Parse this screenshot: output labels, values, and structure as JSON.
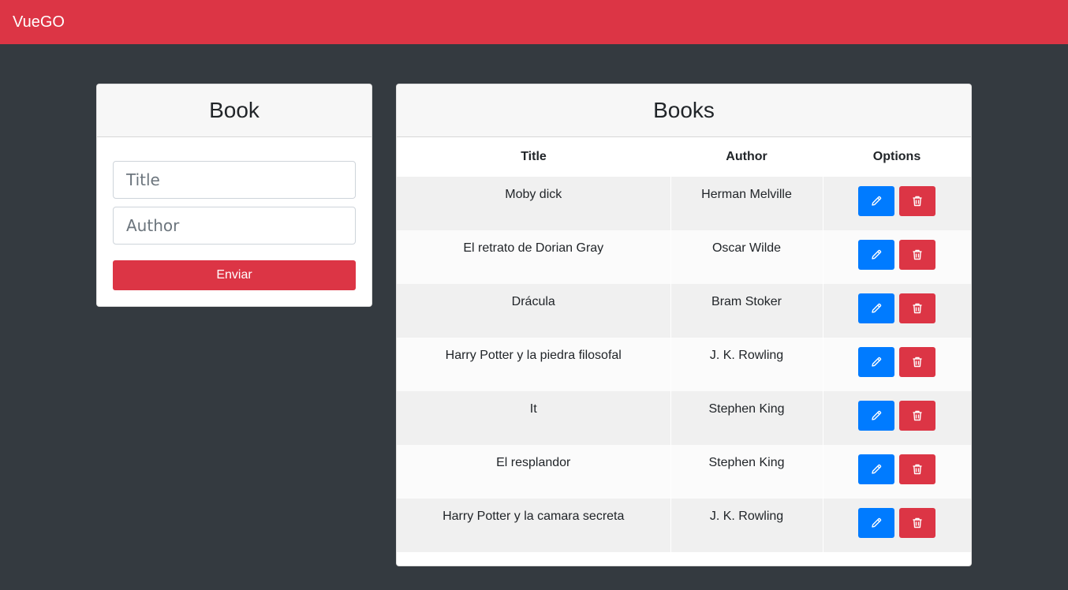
{
  "navbar": {
    "brand": "VueGO",
    "color": "#dc3545"
  },
  "form": {
    "header": "Book",
    "title_placeholder": "Title",
    "author_placeholder": "Author",
    "title_value": "",
    "author_value": "",
    "submit_label": "Enviar"
  },
  "books": {
    "header": "Books",
    "columns": [
      "Title",
      "Author",
      "Options"
    ],
    "rows": [
      {
        "title": "Moby dick",
        "author": "Herman Melville"
      },
      {
        "title": "El retrato de Dorian Gray",
        "author": "Oscar Wilde"
      },
      {
        "title": "Drácula",
        "author": "Bram Stoker"
      },
      {
        "title": "Harry Potter y la piedra filosofal",
        "author": "J. K. Rowling"
      },
      {
        "title": "It",
        "author": "Stephen King"
      },
      {
        "title": "El resplandor",
        "author": "Stephen King"
      },
      {
        "title": "Harry Potter y la camara secreta",
        "author": "J. K. Rowling"
      }
    ],
    "actions": {
      "edit_icon": "pencil-icon",
      "delete_icon": "trash-icon"
    }
  },
  "colors": {
    "background": "#343a40",
    "primary": "#007bff",
    "danger": "#dc3545"
  }
}
